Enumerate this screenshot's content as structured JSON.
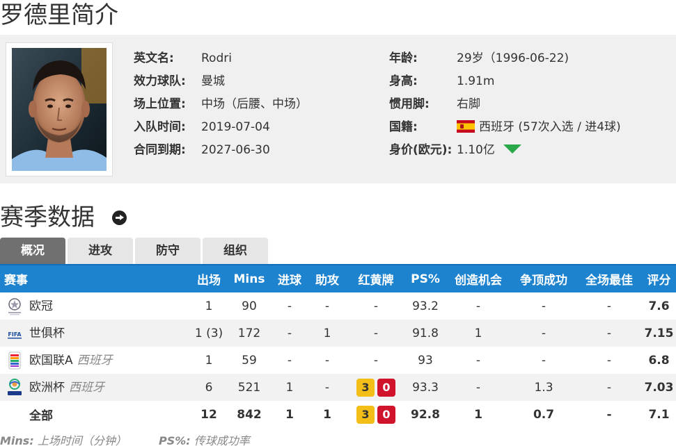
{
  "profile": {
    "title": "罗德里简介",
    "fields_left": [
      {
        "label": "英文名:",
        "value": "Rodri"
      },
      {
        "label": "效力球队:",
        "value": "曼城"
      },
      {
        "label": "场上位置:",
        "value": "中场（后腰、中场）"
      },
      {
        "label": "入队时间:",
        "value": "2019-07-04"
      },
      {
        "label": "合同到期:",
        "value": "2027-06-30"
      }
    ],
    "fields_right": [
      {
        "label": "年龄:",
        "value": "29岁（1996-06-22)"
      },
      {
        "label": "身高:",
        "value": "1.91m"
      },
      {
        "label": "惯用脚:",
        "value": "右脚"
      },
      {
        "label": "国籍:",
        "value": "西班牙 (57次入选 / 进4球)",
        "flag": "spain-flag-icon"
      },
      {
        "label": "身价(欧元):",
        "value": "1.10亿",
        "trend": "down-arrow-icon",
        "trend_color": "#2aa84a"
      }
    ]
  },
  "season": {
    "title": "赛季数据",
    "tabs": [
      "概况",
      "进攻",
      "防守",
      "组织"
    ],
    "active_tab": 0,
    "columns": [
      "赛事",
      "出场",
      "Mins",
      "进球",
      "助攻",
      "红黄牌",
      "PS%",
      "创造机会",
      "争顶成功",
      "全场最佳",
      "评分"
    ],
    "rows": [
      {
        "logo": "champions-league-icon",
        "name": "欧冠",
        "sub": "",
        "apps": "1",
        "mins": "90",
        "goals": "-",
        "assists": "-",
        "cards": "-",
        "ps": "93.2",
        "chances": "-",
        "aerials": "-",
        "motm": "-",
        "rating": "7.6"
      },
      {
        "logo": "fifa-icon",
        "name": "世俱杯",
        "sub": "",
        "apps": "1 (3)",
        "mins": "172",
        "goals": "-",
        "assists": "1",
        "cards": "-",
        "ps": "91.8",
        "chances": "1",
        "aerials": "-",
        "motm": "-",
        "rating": "7.15"
      },
      {
        "logo": "nations-league-icon",
        "name": "欧国联A",
        "sub": "西班牙",
        "apps": "1",
        "mins": "59",
        "goals": "-",
        "assists": "-",
        "cards": "-",
        "ps": "93",
        "chances": "-",
        "aerials": "-",
        "motm": "-",
        "rating": "6.8"
      },
      {
        "logo": "euro-icon",
        "name": "欧洲杯",
        "sub": "西班牙",
        "apps": "6",
        "mins": "521",
        "goals": "1",
        "assists": "-",
        "cards": {
          "yellow": "3",
          "red": "0"
        },
        "ps": "93.3",
        "chances": "-",
        "aerials": "1.3",
        "motm": "-",
        "rating": "7.03"
      }
    ],
    "total": {
      "name": "全部",
      "apps": "12",
      "mins": "842",
      "goals": "1",
      "assists": "1",
      "cards": {
        "yellow": "3",
        "red": "0"
      },
      "ps": "92.8",
      "chances": "1",
      "aerials": "0.7",
      "motm": "-",
      "rating": "7.1"
    },
    "colors": {
      "header": "#1d83cf",
      "rating": "#ef6c00",
      "yellow_card": "#f3be18",
      "red_card": "#d0142c"
    }
  },
  "footnotes": [
    {
      "key": "Mins:",
      "text": "上场时间（分钟）"
    },
    {
      "key": "PS%:",
      "text": "传球成功率"
    }
  ]
}
